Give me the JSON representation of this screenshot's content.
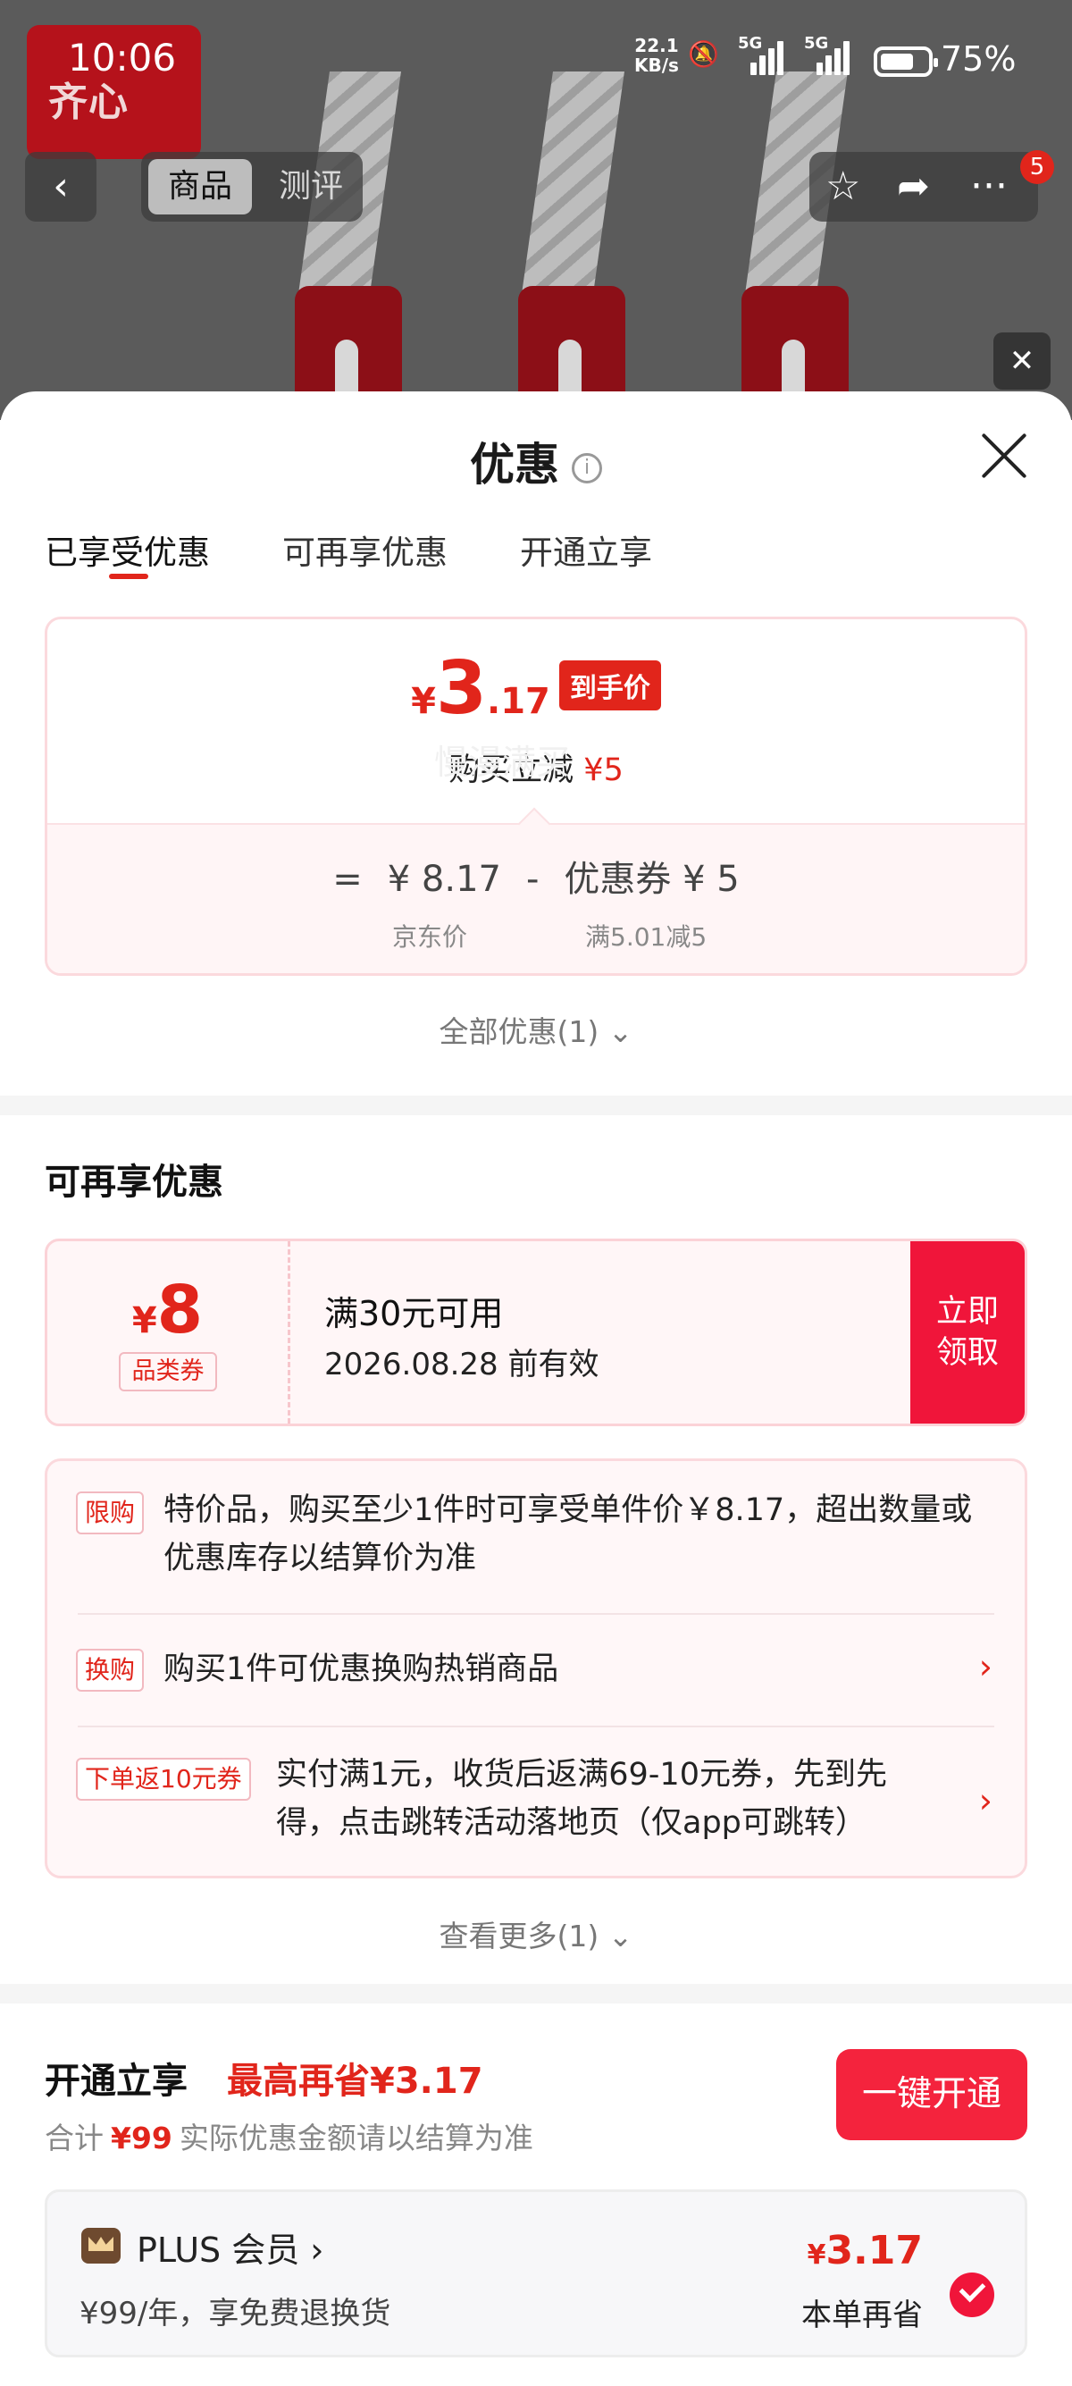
{
  "status": {
    "time": "10:06",
    "net_speed_value": "22.1",
    "net_speed_unit": "KB/s",
    "signal1_label": "5G",
    "signal2_label": "5G",
    "battery": "75%"
  },
  "background": {
    "logo_text": "齐心",
    "nav_back_icon": "chevron-left-icon",
    "nav_tabs": [
      "商品",
      "测评"
    ],
    "cart_badge": "5"
  },
  "sheet": {
    "title": "优惠",
    "info_icon": "i",
    "tabs": [
      "已享受优惠",
      "可再享优惠",
      "开通立享"
    ]
  },
  "price_card": {
    "yen": "¥",
    "price_int": "3",
    "price_dec": ".17",
    "price_tag": "到手价",
    "direct_label": "购买立减",
    "direct_value": "¥5",
    "eq": "=",
    "jd_price": "¥ 8.17",
    "minus": "-",
    "coupon_label": "优惠券 ¥ 5",
    "jd_price_label": "京东价",
    "coupon_rule": "满5.01减5"
  },
  "all_discount": "全部优惠(1) ⌄",
  "watermark": "慢漫满买",
  "more_section": {
    "title": "可再享优惠",
    "coupon": {
      "yen": "¥",
      "amount": "8",
      "type": "品类券",
      "condition": "满30元可用",
      "expiry": "2026.08.28 前有效",
      "button_line1": "立即",
      "button_line2": "领取"
    },
    "promos": [
      {
        "tag": "限购",
        "text_line1": "特价品，购买至少1件时可享受单件价￥8.17，超出数量或",
        "text_line2": "优惠库存以结算价为准"
      },
      {
        "tag": "换购",
        "text_line1": "购买1件可优惠换购热销商品"
      },
      {
        "tag": "下单返10元券",
        "text_line1": "实付满1元，收货后返满69-10元券，先到先",
        "text_line2": "得，点击跳转活动落地页（仅app可跳转）"
      }
    ],
    "see_more": "查看更多(1) ⌄"
  },
  "plus_section": {
    "title": "开通立享",
    "max_save": "最高再省¥3.17",
    "total_label": "合计",
    "total_value": "¥99",
    "total_note": "实际优惠金额请以结算为准",
    "open_button": "一键开通",
    "member_name": "PLUS 会员 ›",
    "member_desc": "¥99/年，享免费退换货",
    "member_yen": "¥",
    "member_save": "3.17",
    "member_save_note": "本单再省"
  }
}
